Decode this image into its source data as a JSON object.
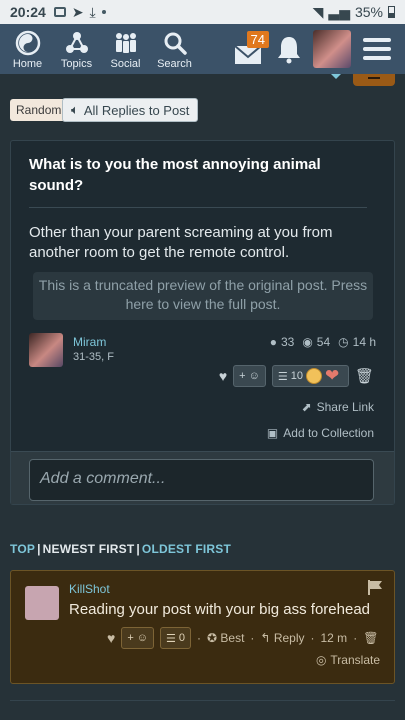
{
  "status_bar": {
    "time": "20:24",
    "battery": "35%"
  },
  "nav": {
    "items": [
      {
        "label": "Home",
        "icon": "yin-yang-icon"
      },
      {
        "label": "Topics",
        "icon": "topics-icon"
      },
      {
        "label": "Social",
        "icon": "people-icon"
      },
      {
        "label": "Search",
        "icon": "search-icon"
      }
    ],
    "notification_count": "74"
  },
  "actions": {
    "random_label": "Random",
    "all_replies_label": "All Replies to Post"
  },
  "post": {
    "title": "What is to you the most annoying animal sound?",
    "body": "Other than your parent screaming at you from another room to get the remote control.",
    "preview_notice": "This is a truncated preview of the original post. Press here to view the full post.",
    "author": {
      "name": "Miram",
      "meta": "31-35, F"
    },
    "stats": {
      "comments": "33",
      "views": "54",
      "age": "14 h"
    },
    "reactions": {
      "add_label": "+",
      "list_count": "10"
    },
    "share_label": "Share Link",
    "collection_label": "Add to Collection",
    "comment_placeholder": "Add a comment..."
  },
  "sort": {
    "top": "TOP",
    "newest": "NEWEST FIRST",
    "oldest": "OLDEST FIRST"
  },
  "reply": {
    "author": "KillShot",
    "text": "Reading your post with your big ass forehead",
    "add_label": "+",
    "list_count": "0",
    "best_label": "Best",
    "reply_label": "Reply",
    "age": "12 m",
    "translate_label": "Translate"
  },
  "colors": {
    "accent": "#7ec6d9",
    "navbar": "#3b5268",
    "badge": "#e0781d",
    "reply_bg": "#3b2b10"
  }
}
